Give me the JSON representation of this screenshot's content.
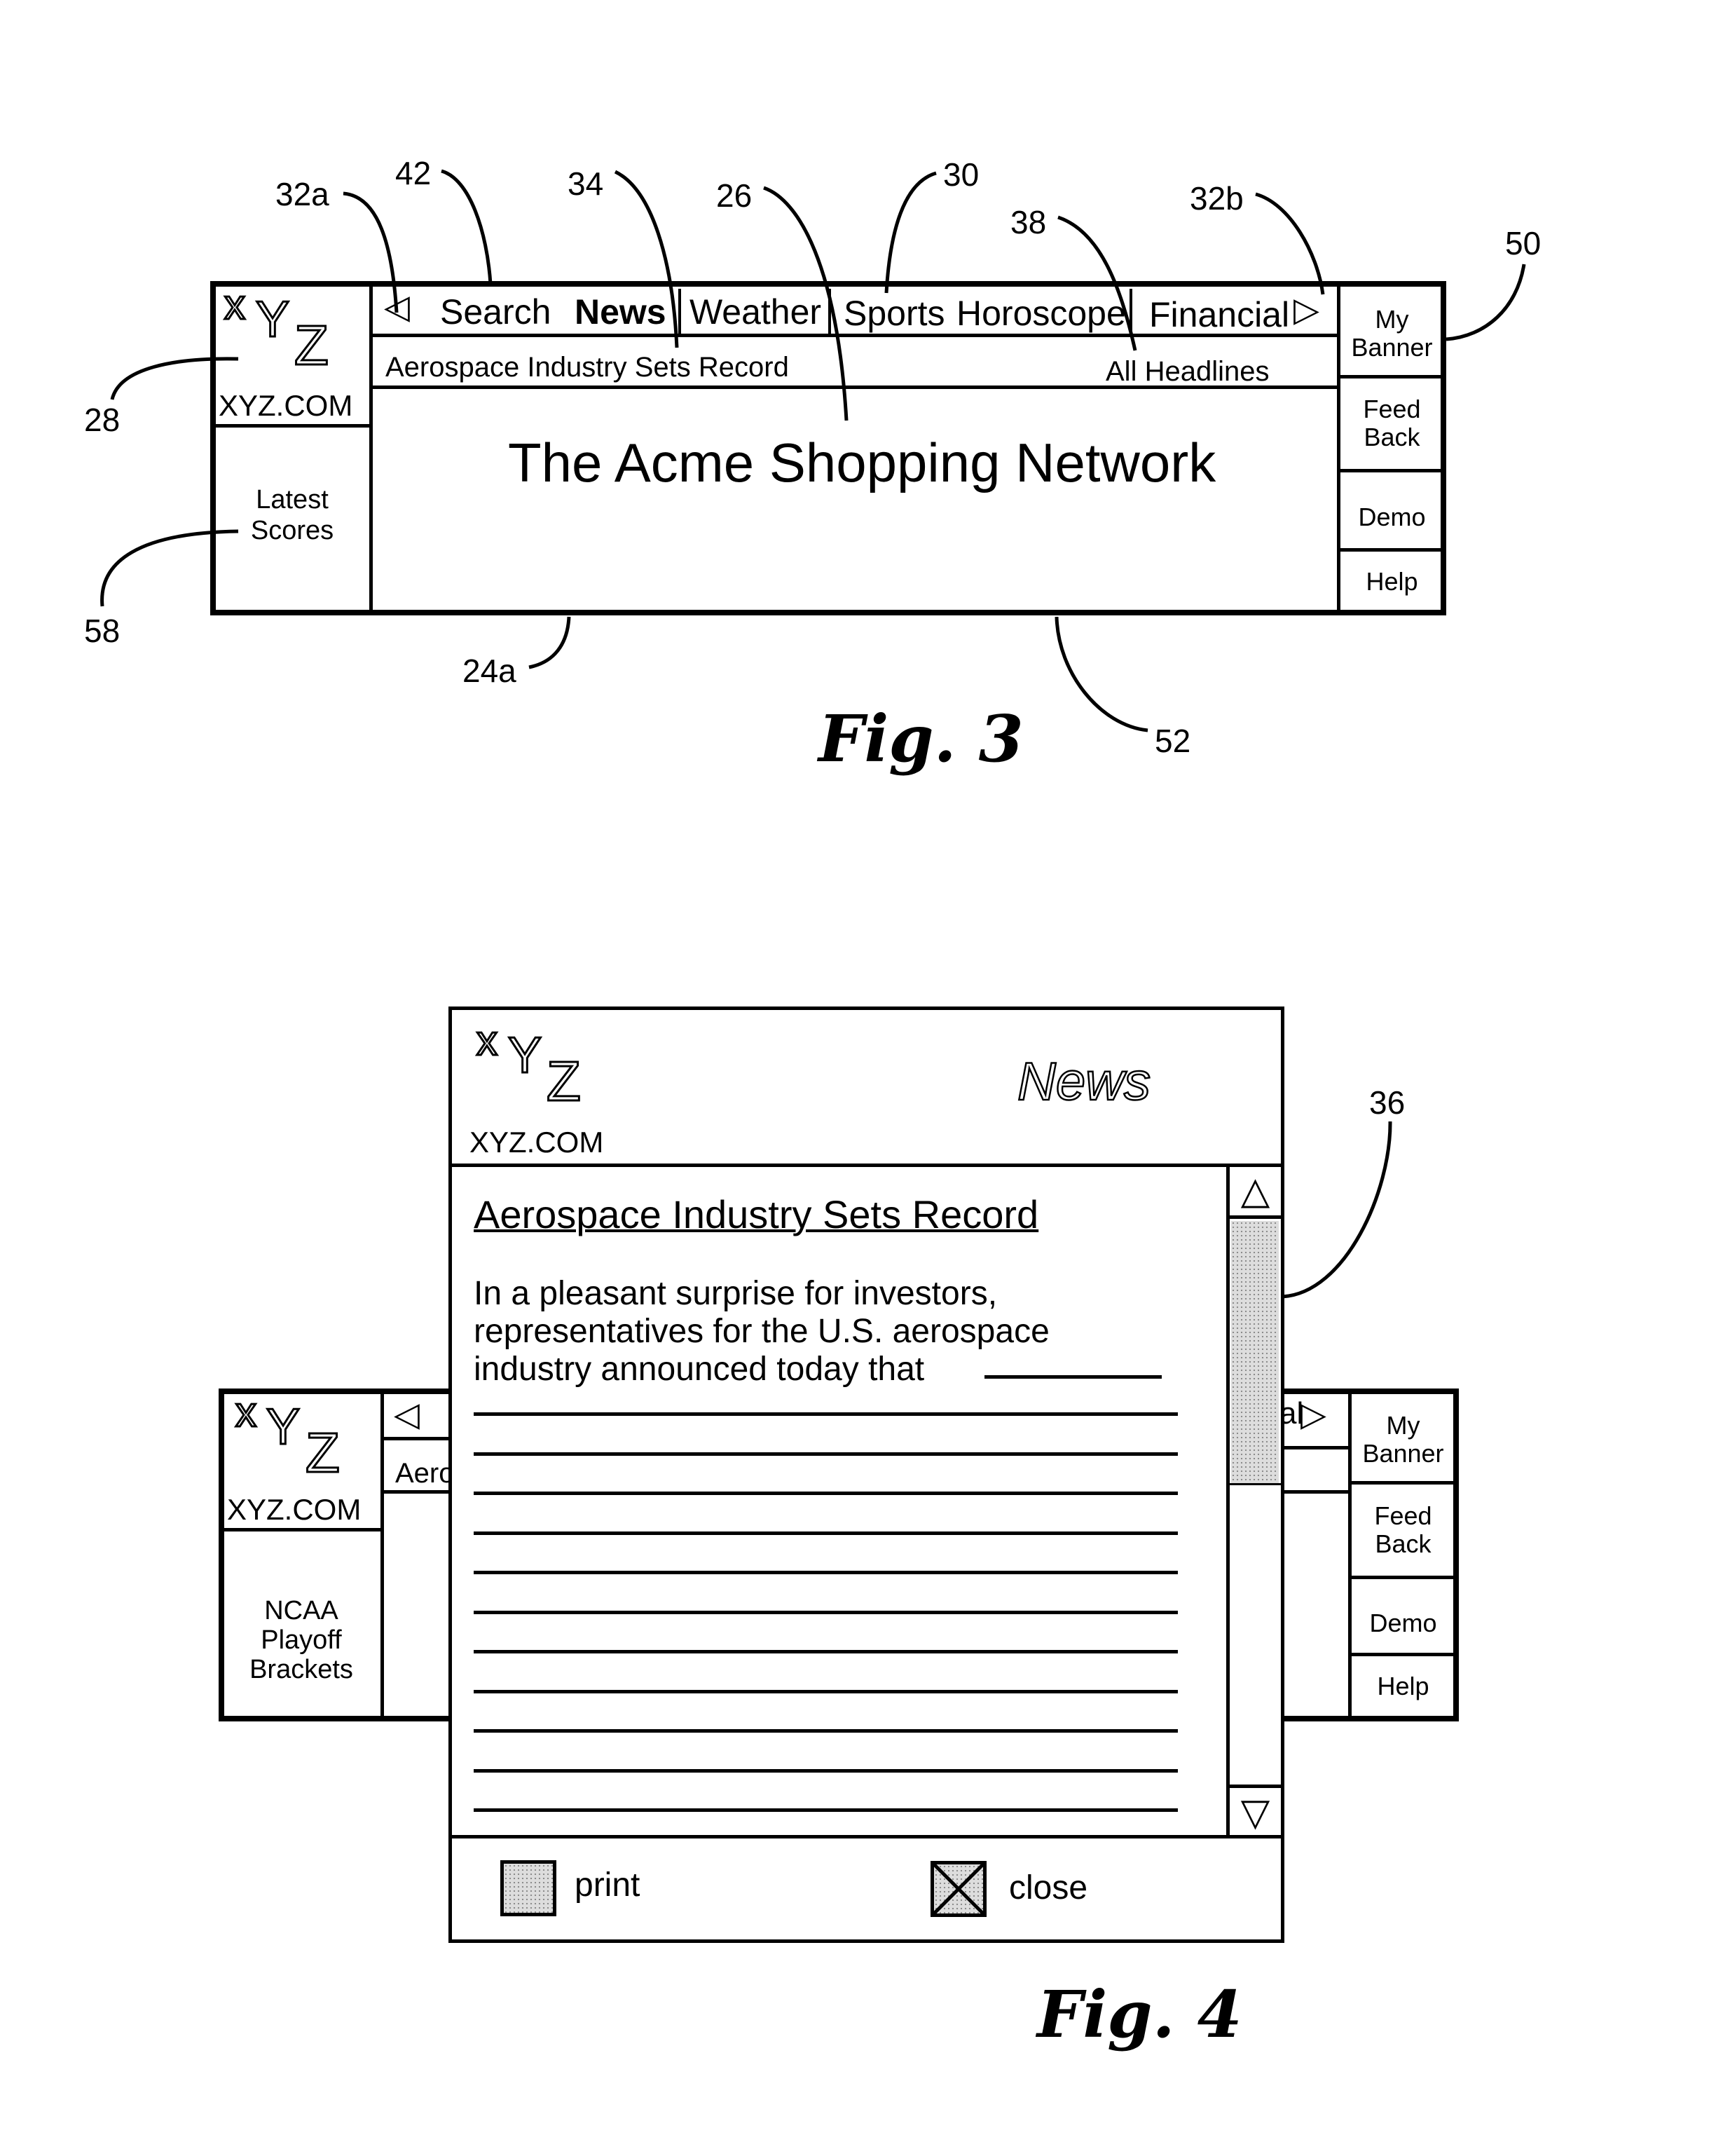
{
  "fig3": {
    "caption": "Fig. 3",
    "logo": {
      "x": "x",
      "y": "Y",
      "z": "Z",
      "domain": "XYZ.COM"
    },
    "nav": {
      "left_arrow": "◁",
      "right_arrow": "▷",
      "tabs": [
        {
          "label": "Search",
          "bold": false
        },
        {
          "label": "News",
          "bold": true
        },
        {
          "label": "Weather",
          "bold": false
        },
        {
          "label": "Sports",
          "bold": false
        },
        {
          "label": "Horoscope",
          "bold": false
        },
        {
          "label": "Financial",
          "bold": false
        }
      ]
    },
    "headline": "Aerospace Industry Sets Record",
    "all_headlines": "All Headlines",
    "banner_ad": "The Acme Shopping Network",
    "side_panel": "Latest Scores",
    "right_buttons": [
      "My Banner",
      "Feed Back",
      "Demo",
      "Help"
    ],
    "refs": {
      "r32a": "32a",
      "r42": "42",
      "r34": "34",
      "r26": "26",
      "r30": "30",
      "r38": "38",
      "r32b": "32b",
      "r50": "50",
      "r28": "28",
      "r58": "58",
      "r24a": "24a",
      "r52": "52"
    }
  },
  "fig4": {
    "caption": "Fig. 4",
    "background_window": {
      "logo": {
        "x": "x",
        "y": "Y",
        "z": "Z",
        "domain": "XYZ.COM"
      },
      "left_arrow": "◁",
      "partial_headline": "Aero",
      "partial_tab": "al",
      "right_arrow": "▷",
      "side_panel": "NCAA Playoff Brackets",
      "right_buttons": [
        "My Banner",
        "Feed Back",
        "Demo",
        "Help"
      ]
    },
    "popup": {
      "logo": {
        "x": "x",
        "y": "Y",
        "z": "Z",
        "domain": "XYZ.COM"
      },
      "section_title": "News",
      "article_title": "Aerospace Industry Sets Record",
      "article_lines": [
        "In a pleasant surprise for investors,",
        "representatives for the U.S. aerospace",
        "industry  announced  today that"
      ],
      "placeholder_line_count": 11,
      "scroll_up": "△",
      "scroll_down": "▽",
      "scroll_position": 0.0,
      "print_label": "print",
      "close_label": "close"
    },
    "refs": {
      "r36": "36"
    }
  }
}
